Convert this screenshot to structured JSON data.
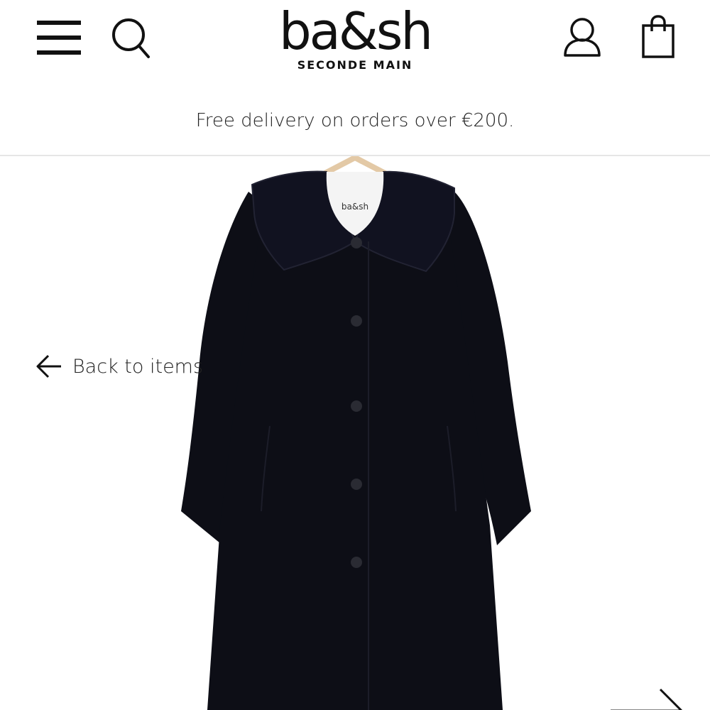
{
  "header": {
    "brand": "ba&sh",
    "brand_sub": "SECONDE MAIN",
    "icons": {
      "menu": "hamburger-menu-icon",
      "search": "search-icon",
      "account": "user-account-icon",
      "bag": "shopping-bag-icon"
    }
  },
  "promo": {
    "text": "Free delivery on orders over €200."
  },
  "product": {
    "label_text": "ba&sh",
    "garment_color": "#0d0e16",
    "back_label": "Back to items",
    "back_icon": "arrow-left-icon",
    "next_icon": "arrow-right-icon"
  },
  "colors": {
    "background": "#ffffff",
    "text": "#111111",
    "divider": "#e6e6e6"
  }
}
